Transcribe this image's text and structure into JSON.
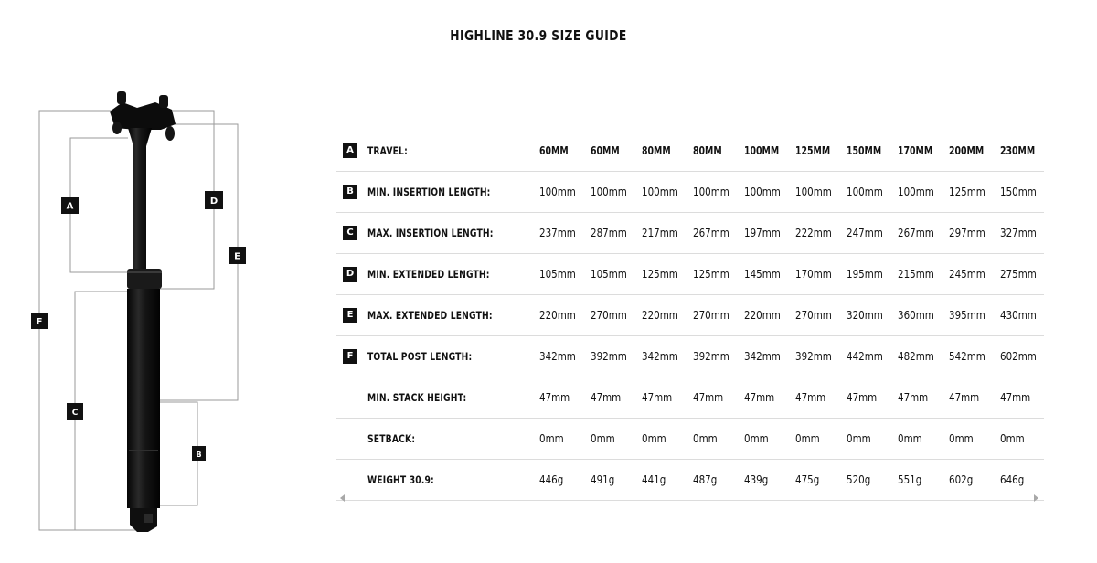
{
  "title": "HIGHLINE 30.9 SIZE GUIDE",
  "diagram": {
    "badges": [
      "A",
      "B",
      "C",
      "D",
      "E",
      "F"
    ]
  },
  "table": {
    "header": {
      "badge": "A",
      "label": "TRAVEL:",
      "values": [
        "60MM",
        "60MM",
        "80MM",
        "80MM",
        "100MM",
        "125MM",
        "150MM",
        "170MM",
        "200MM",
        "230MM"
      ]
    },
    "rows": [
      {
        "badge": "B",
        "label": "MIN. INSERTION LENGTH:",
        "values": [
          "100mm",
          "100mm",
          "100mm",
          "100mm",
          "100mm",
          "100mm",
          "100mm",
          "100mm",
          "125mm",
          "150mm"
        ]
      },
      {
        "badge": "C",
        "label": "MAX. INSERTION LENGTH:",
        "values": [
          "237mm",
          "287mm",
          "217mm",
          "267mm",
          "197mm",
          "222mm",
          "247mm",
          "267mm",
          "297mm",
          "327mm"
        ]
      },
      {
        "badge": "D",
        "label": "MIN. EXTENDED LENGTH:",
        "values": [
          "105mm",
          "105mm",
          "125mm",
          "125mm",
          "145mm",
          "170mm",
          "195mm",
          "215mm",
          "245mm",
          "275mm"
        ]
      },
      {
        "badge": "E",
        "label": "MAX. EXTENDED LENGTH:",
        "values": [
          "220mm",
          "270mm",
          "220mm",
          "270mm",
          "220mm",
          "270mm",
          "320mm",
          "360mm",
          "395mm",
          "430mm"
        ]
      },
      {
        "badge": "F",
        "label": "TOTAL POST LENGTH:",
        "values": [
          "342mm",
          "392mm",
          "342mm",
          "392mm",
          "342mm",
          "392mm",
          "442mm",
          "482mm",
          "542mm",
          "602mm"
        ]
      },
      {
        "badge": "",
        "label": "MIN. STACK HEIGHT:",
        "values": [
          "47mm",
          "47mm",
          "47mm",
          "47mm",
          "47mm",
          "47mm",
          "47mm",
          "47mm",
          "47mm",
          "47mm"
        ]
      },
      {
        "badge": "",
        "label": "SETBACK:",
        "values": [
          "0mm",
          "0mm",
          "0mm",
          "0mm",
          "0mm",
          "0mm",
          "0mm",
          "0mm",
          "0mm",
          "0mm"
        ]
      },
      {
        "badge": "",
        "label": "WEIGHT 30.9:",
        "values": [
          "446g",
          "491g",
          "441g",
          "487g",
          "439g",
          "475g",
          "520g",
          "551g",
          "602g",
          "646g"
        ]
      }
    ]
  },
  "scrollbar": {
    "left_icon": "scroll-left-arrow-icon",
    "right_icon": "scroll-right-arrow-icon"
  }
}
